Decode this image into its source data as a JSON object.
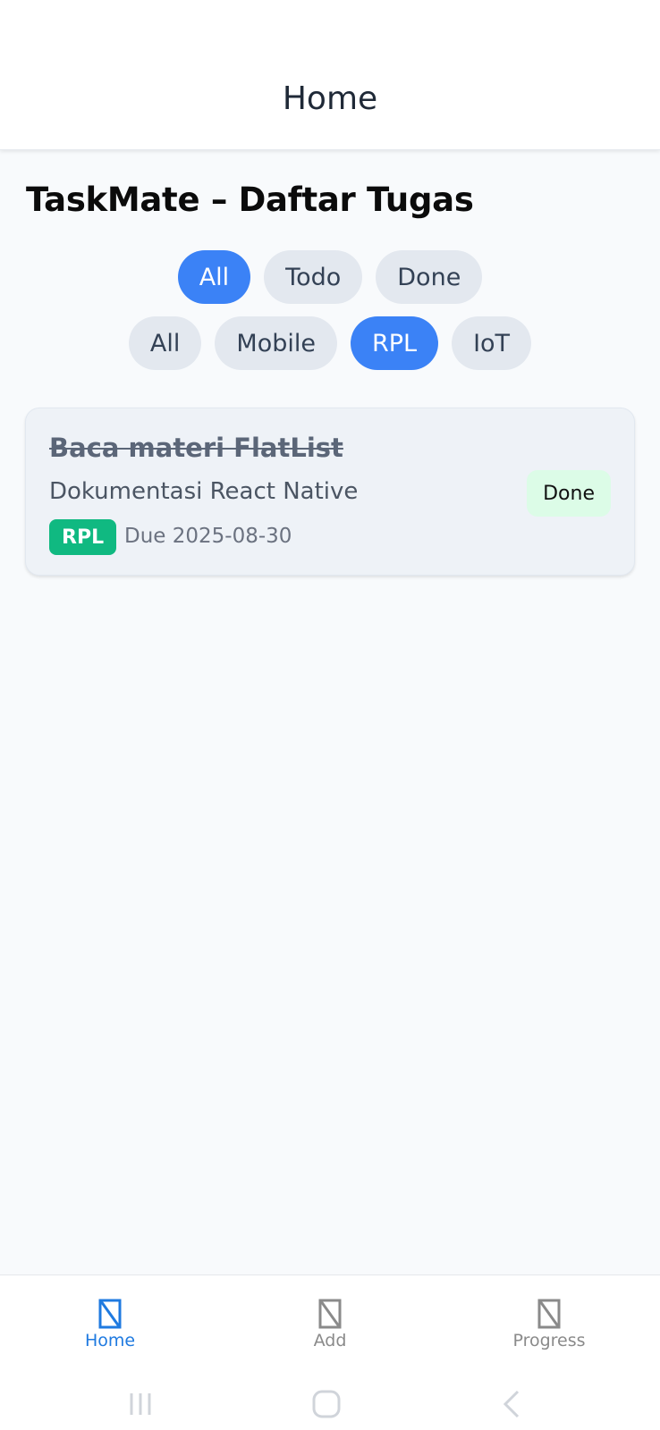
{
  "header": {
    "title": "Home"
  },
  "page_title": "TaskMate – Daftar Tugas",
  "status_filters": [
    {
      "label": "All",
      "active": true
    },
    {
      "label": "Todo",
      "active": false
    },
    {
      "label": "Done",
      "active": false
    }
  ],
  "category_filters": [
    {
      "label": "All",
      "active": false
    },
    {
      "label": "Mobile",
      "active": false
    },
    {
      "label": "RPL",
      "active": true
    },
    {
      "label": "IoT",
      "active": false
    }
  ],
  "tasks": [
    {
      "title": "Baca materi FlatList",
      "description": "Dokumentasi React Native",
      "category": "RPL",
      "due": "Due 2025-08-30",
      "status": "Done"
    }
  ],
  "tabs": [
    {
      "label": "Home",
      "icon": "placeholder-icon",
      "active": true
    },
    {
      "label": "Add",
      "icon": "placeholder-icon",
      "active": false
    },
    {
      "label": "Progress",
      "icon": "placeholder-icon",
      "active": false
    }
  ],
  "colors": {
    "accent": "#3b82f6",
    "category_rpl": "#10b981",
    "status_done_bg": "#dcfce7",
    "tab_active": "#1f7ae0"
  }
}
